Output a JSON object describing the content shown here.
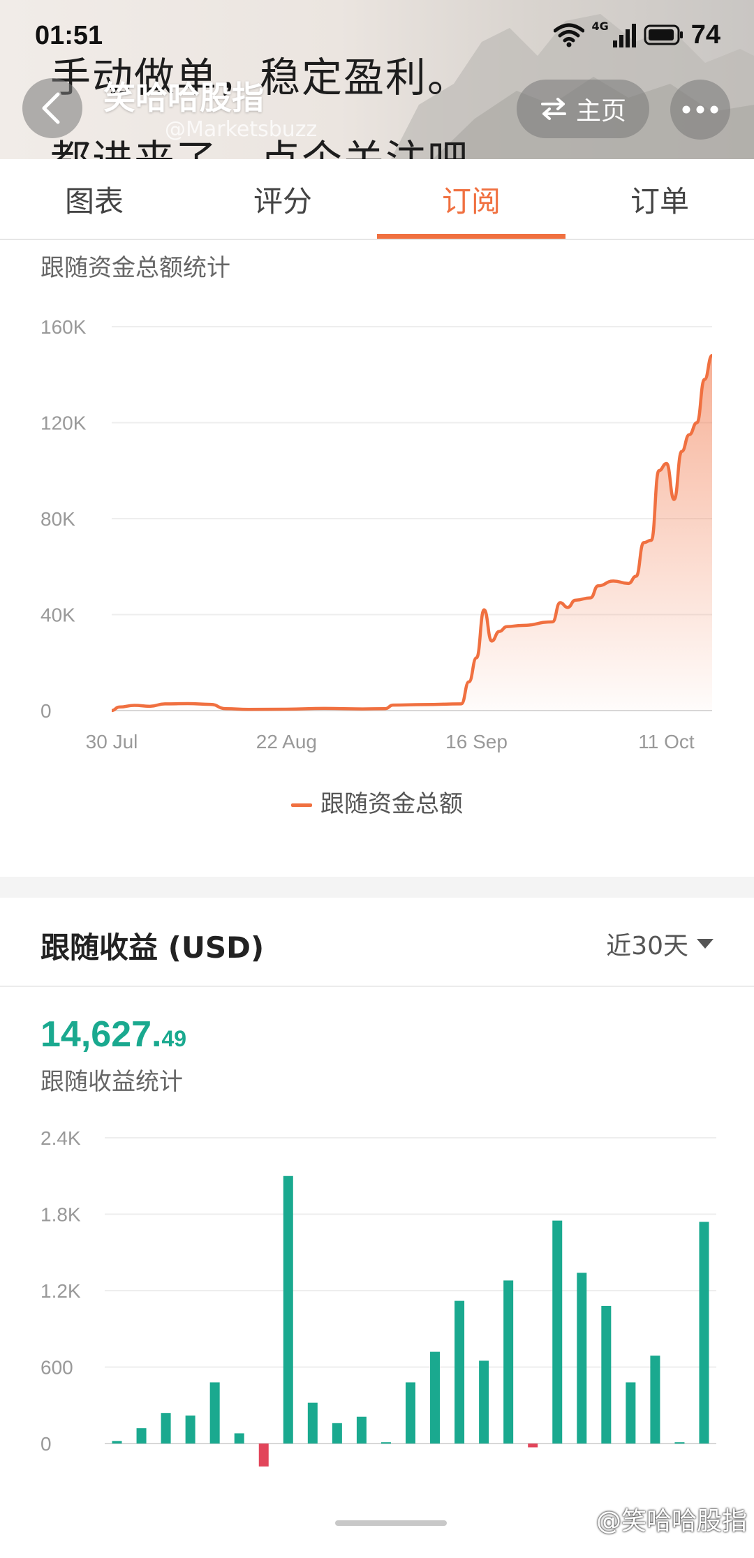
{
  "status_bar": {
    "time": "01:51",
    "network": "4G",
    "battery": "74"
  },
  "header": {
    "background_line1": "手动做单，稳定盈利。",
    "background_line2": "都进来了，点个关注吧。",
    "account_name": "笑哈哈股指",
    "account_handle": "@Marketsbuzz",
    "home_button": "主页",
    "icons": [
      "back-arrow-icon",
      "switch-arrows-icon",
      "more-dots-icon"
    ]
  },
  "tabs": [
    {
      "label": "图表",
      "active": false
    },
    {
      "label": "评分",
      "active": false
    },
    {
      "label": "订阅",
      "active": true
    },
    {
      "label": "订单",
      "active": false
    }
  ],
  "follow_funds": {
    "subtitle": "跟随资金总额统计",
    "legend": "跟随资金总额",
    "line_color": "#f07040"
  },
  "earnings": {
    "title": "跟随收益 (USD)",
    "period": "近30天",
    "total_integer": "14,627.",
    "total_decimal": "49",
    "subtitle": "跟随收益统计",
    "positive_color": "#1aa98f",
    "negative_color": "#e2455a"
  },
  "watermark": "@笑哈哈股指",
  "chart_data": [
    {
      "type": "area",
      "y_ticks": [
        "160K",
        "120K",
        "80K",
        "40K",
        "0"
      ],
      "ylim": [
        0,
        160000
      ],
      "x_ticks": [
        "30 Jul",
        "22 Aug",
        "16 Sep",
        "11 Oct"
      ],
      "series": [
        {
          "name": "跟随资金总额",
          "points": [
            [
              "2024-07-30",
              0
            ],
            [
              "2024-07-31",
              1500
            ],
            [
              "2024-08-02",
              2200
            ],
            [
              "2024-08-04",
              1800
            ],
            [
              "2024-08-06",
              2800
            ],
            [
              "2024-08-09",
              2900
            ],
            [
              "2024-08-12",
              2600
            ],
            [
              "2024-08-14",
              800
            ],
            [
              "2024-08-17",
              500
            ],
            [
              "2024-08-22",
              600
            ],
            [
              "2024-08-27",
              900
            ],
            [
              "2024-09-01",
              700
            ],
            [
              "2024-09-04",
              800
            ],
            [
              "2024-09-05",
              2300
            ],
            [
              "2024-09-09",
              2500
            ],
            [
              "2024-09-14",
              2800
            ],
            [
              "2024-09-15",
              12000
            ],
            [
              "2024-09-16",
              22000
            ],
            [
              "2024-09-17",
              42000
            ],
            [
              "2024-09-18",
              29000
            ],
            [
              "2024-09-19",
              33000
            ],
            [
              "2024-09-20",
              35000
            ],
            [
              "2024-09-22",
              35500
            ],
            [
              "2024-09-26",
              37000
            ],
            [
              "2024-09-27",
              45000
            ],
            [
              "2024-09-28",
              43000
            ],
            [
              "2024-09-29",
              46000
            ],
            [
              "2024-10-01",
              47000
            ],
            [
              "2024-10-02",
              52000
            ],
            [
              "2024-10-04",
              54000
            ],
            [
              "2024-10-06",
              53000
            ],
            [
              "2024-10-07",
              56000
            ],
            [
              "2024-10-08",
              70000
            ],
            [
              "2024-10-09",
              71000
            ],
            [
              "2024-10-10",
              100000
            ],
            [
              "2024-10-11",
              103000
            ],
            [
              "2024-10-12",
              88000
            ],
            [
              "2024-10-13",
              108000
            ],
            [
              "2024-10-14",
              115000
            ],
            [
              "2024-10-15",
              120000
            ],
            [
              "2024-10-16",
              138000
            ],
            [
              "2024-10-17",
              148000
            ]
          ]
        }
      ]
    },
    {
      "type": "bar",
      "y_ticks": [
        "2.4K",
        "1.8K",
        "1.2K",
        "600",
        "0"
      ],
      "ylim": [
        -300,
        2400
      ],
      "values": [
        20,
        120,
        240,
        220,
        480,
        80,
        -180,
        2100,
        320,
        160,
        210,
        10,
        480,
        720,
        1120,
        650,
        1280,
        -30,
        1750,
        1340,
        1080,
        480,
        690,
        10,
        1740
      ]
    }
  ]
}
